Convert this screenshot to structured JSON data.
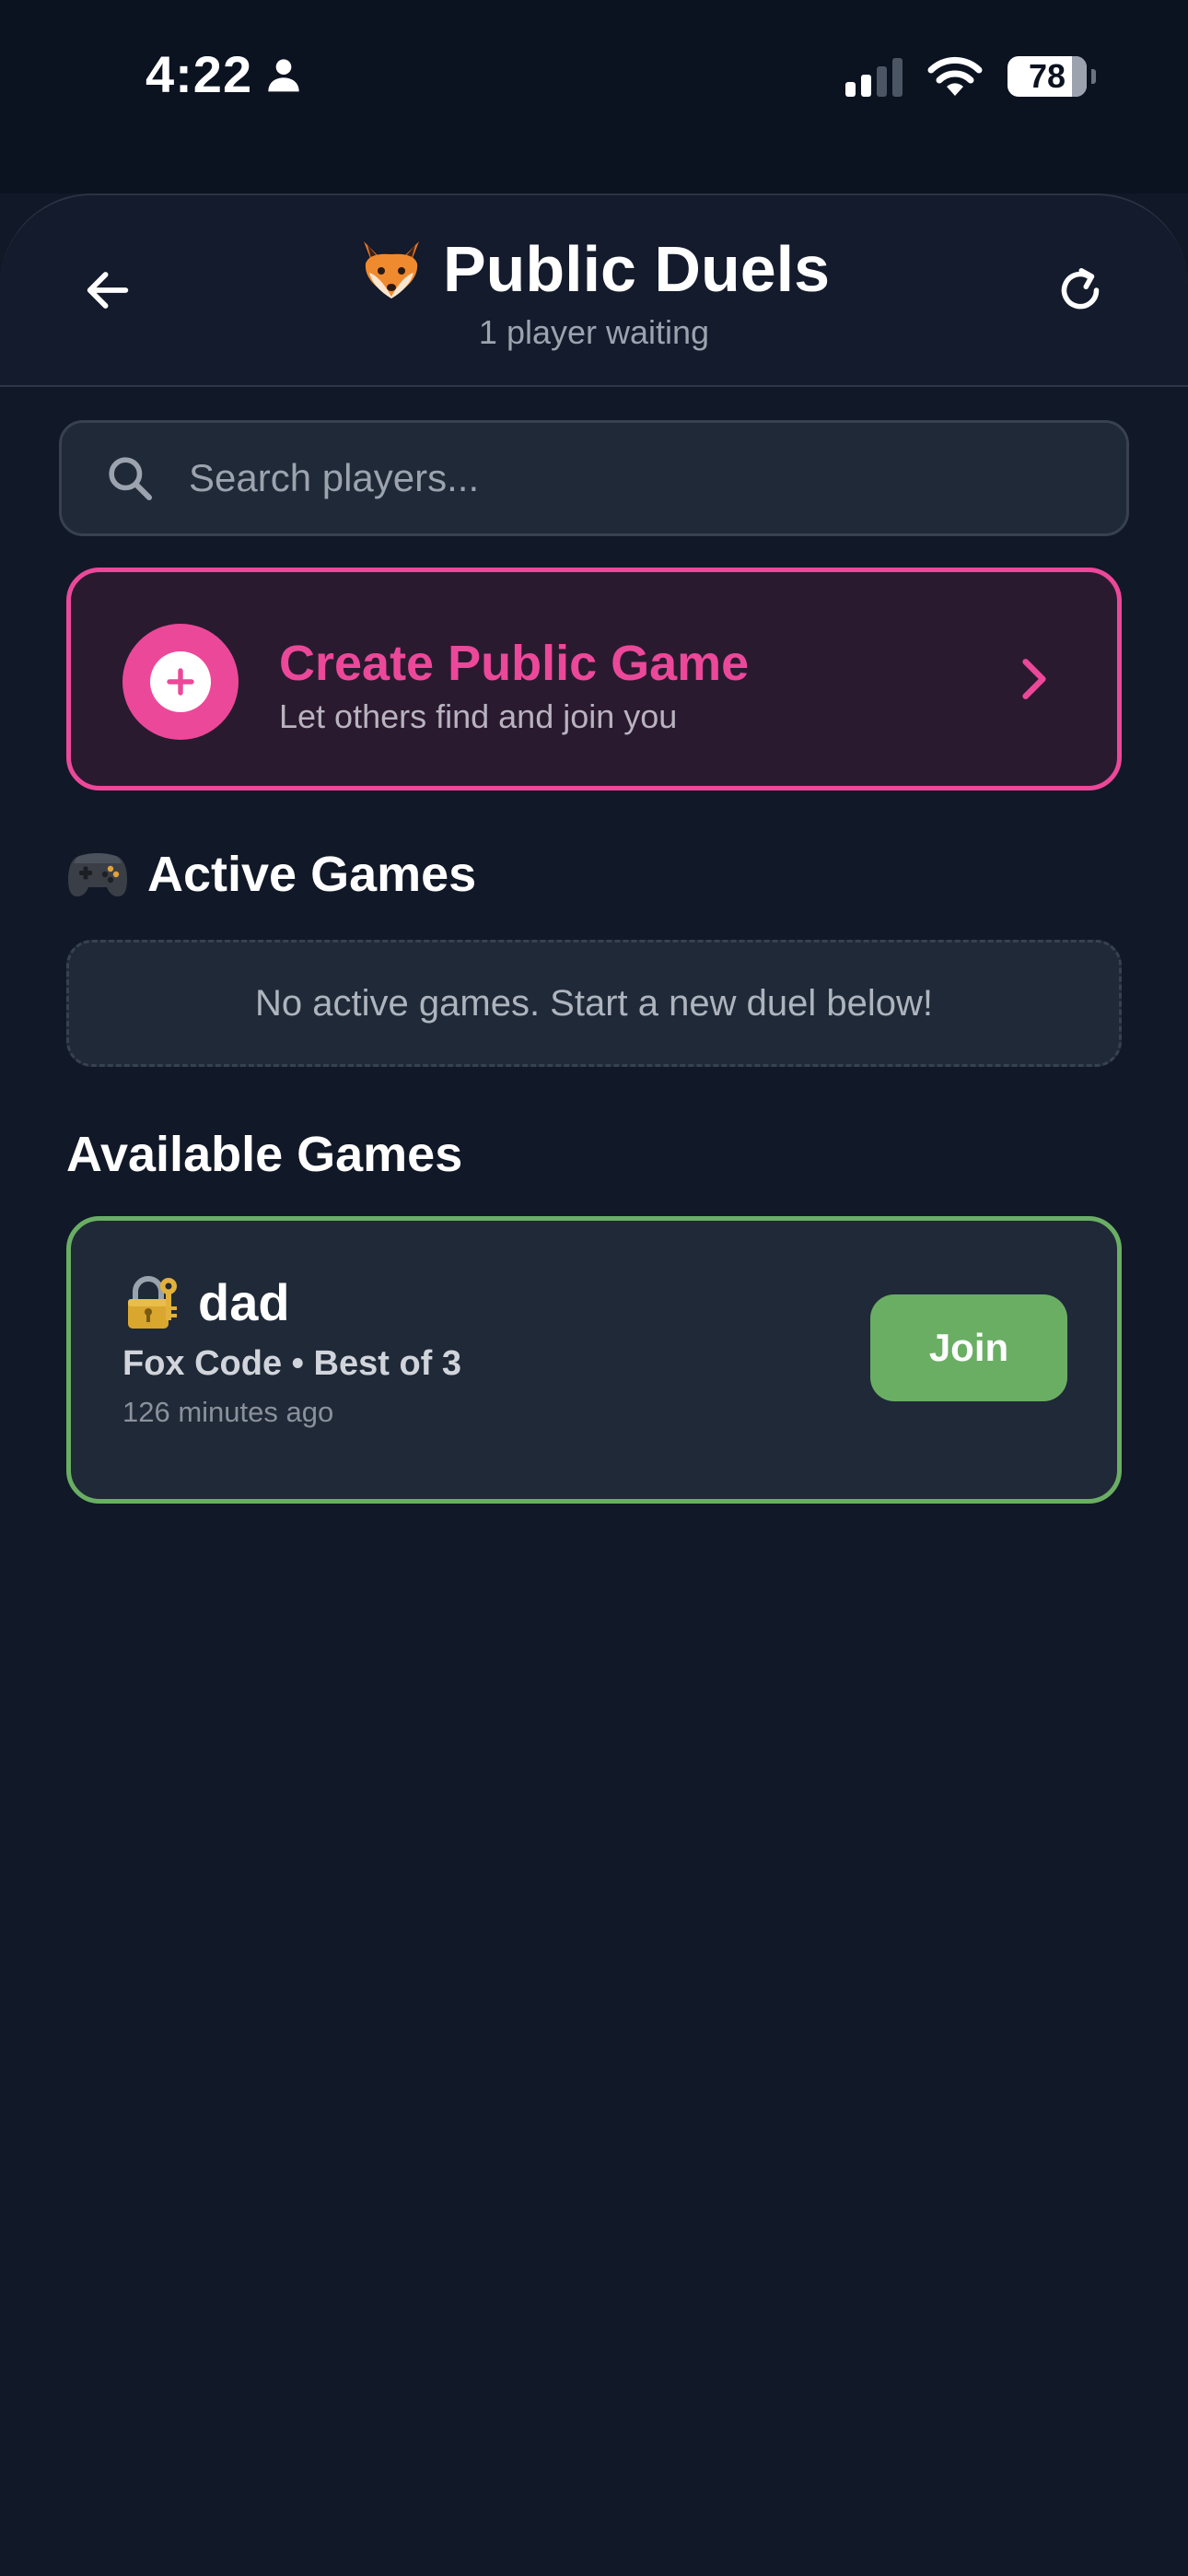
{
  "status_bar": {
    "time": "4:22",
    "battery": "78"
  },
  "header": {
    "title": "Public Duels",
    "subtitle": "1 player waiting"
  },
  "search": {
    "placeholder": "Search players..."
  },
  "create_game": {
    "title": "Create Public Game",
    "subtitle": "Let others find and join you"
  },
  "active_games": {
    "heading": "Active Games",
    "empty_message": "No active games. Start a new duel below!"
  },
  "available_games": {
    "heading": "Available Games",
    "games": [
      {
        "name": "dad",
        "meta": "Fox Code • Best of 3",
        "time": "126 minutes ago",
        "join_label": "Join"
      }
    ]
  },
  "colors": {
    "background": "#111827",
    "accent_pink": "#ec4899",
    "accent_green": "#6aae64"
  },
  "icons": [
    "person-icon",
    "signal-icon",
    "wifi-icon",
    "battery-icon",
    "back-arrow-icon",
    "fox-icon",
    "refresh-icon",
    "search-icon",
    "plus-icon",
    "chevron-right-icon",
    "gamepad-icon",
    "lock-key-icon"
  ]
}
